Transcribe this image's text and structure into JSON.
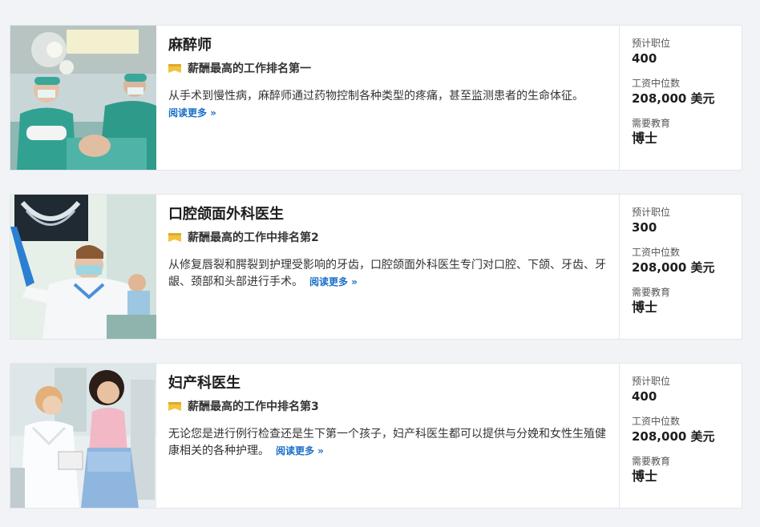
{
  "jobs": [
    {
      "title": "麻醉师",
      "rank": "薪酬最高的工作排名第一",
      "description": "从手术到慢性病，麻醉师通过药物控制各种类型的疼痛，甚至监测患者的生命体征。",
      "read_more": "阅读更多 »",
      "stats": {
        "positions_label": "预计职位",
        "positions_value": "400",
        "salary_label": "工资中位数",
        "salary_value": "208,000 美元",
        "education_label": "需要教育",
        "education_value": "博士"
      }
    },
    {
      "title": "口腔颌面外科医生",
      "rank": "薪酬最高的工作中排名第2",
      "description": "从修复唇裂和腭裂到护理受影响的牙齿，口腔颌面外科医生专门对口腔、下颌、牙齿、牙龈、颈部和头部进行手术。",
      "read_more": "阅读更多 »",
      "stats": {
        "positions_label": "预计职位",
        "positions_value": "300",
        "salary_label": "工资中位数",
        "salary_value": "208,000 美元",
        "education_label": "需要教育",
        "education_value": "博士"
      }
    },
    {
      "title": "妇产科医生",
      "rank": "薪酬最高的工作中排名第3",
      "description": "无论您是进行例行检查还是生下第一个孩子，妇产科医生都可以提供与分娩和女性生殖健康相关的各种护理。",
      "read_more": "阅读更多 »",
      "stats": {
        "positions_label": "预计职位",
        "positions_value": "400",
        "salary_label": "工资中位数",
        "salary_value": "208,000 美元",
        "education_label": "需要教育",
        "education_value": "博士"
      }
    }
  ],
  "colors": {
    "link": "#1a6fc9",
    "rank_icon": "#f3c33e",
    "background": "#f1f3f6"
  },
  "icons": {
    "rank": "ribbon-badge-icon"
  }
}
